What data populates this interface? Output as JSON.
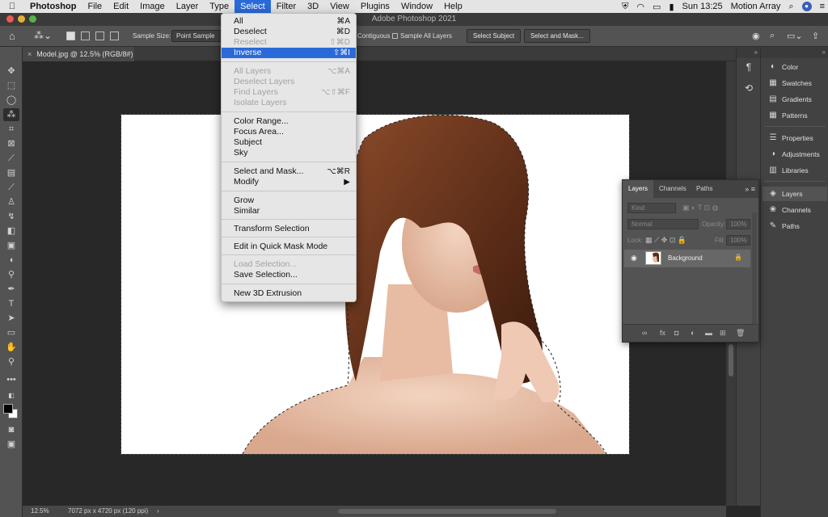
{
  "menubar": {
    "apple": "",
    "items": [
      "Photoshop",
      "File",
      "Edit",
      "Image",
      "Layer",
      "Type",
      "Select",
      "Filter",
      "3D",
      "View",
      "Plugins",
      "Window",
      "Help"
    ],
    "clock": "Sun 13:25",
    "user": "Motion Array"
  },
  "window": {
    "title": "Adobe Photoshop 2021"
  },
  "options": {
    "sample_size_label": "Sample Size:",
    "sample_size_value": "Point Sample",
    "contiguous": "Contiguous",
    "sample_all_layers": "Sample All Layers",
    "select_subject": "Select Subject",
    "select_and_mask": "Select and Mask..."
  },
  "document": {
    "tab": "Model.jpg @ 12.5% (RGB/8#)"
  },
  "status": {
    "zoom": "12.5%",
    "info": "7072 px x 4720 px (120 ppi)",
    "chevron": "›"
  },
  "select_menu": {
    "items": [
      {
        "label": "All",
        "shortcut": "⌘A",
        "disabled": false
      },
      {
        "label": "Deselect",
        "shortcut": "⌘D",
        "disabled": false
      },
      {
        "label": "Reselect",
        "shortcut": "⇧⌘D",
        "disabled": true
      },
      {
        "label": "Inverse",
        "shortcut": "⇧⌘I",
        "disabled": false,
        "highlighted": true
      },
      {
        "label": "All Layers",
        "shortcut": "⌥⌘A",
        "disabled": true
      },
      {
        "label": "Deselect Layers",
        "shortcut": "",
        "disabled": true
      },
      {
        "label": "Find Layers",
        "shortcut": "⌥⇧⌘F",
        "disabled": true
      },
      {
        "label": "Isolate Layers",
        "shortcut": "",
        "disabled": true
      },
      {
        "label": "Color Range...",
        "shortcut": "",
        "disabled": false
      },
      {
        "label": "Focus Area...",
        "shortcut": "",
        "disabled": false
      },
      {
        "label": "Subject",
        "shortcut": "",
        "disabled": false
      },
      {
        "label": "Sky",
        "shortcut": "",
        "disabled": false
      },
      {
        "label": "Select and Mask...",
        "shortcut": "⌥⌘R",
        "disabled": false
      },
      {
        "label": "Modify",
        "shortcut": "▶",
        "disabled": false
      },
      {
        "label": "Grow",
        "shortcut": "",
        "disabled": false
      },
      {
        "label": "Similar",
        "shortcut": "",
        "disabled": false
      },
      {
        "label": "Transform Selection",
        "shortcut": "",
        "disabled": false
      },
      {
        "label": "Edit in Quick Mask Mode",
        "shortcut": "",
        "disabled": false
      },
      {
        "label": "Load Selection...",
        "shortcut": "",
        "disabled": true
      },
      {
        "label": "Save Selection...",
        "shortcut": "",
        "disabled": false
      },
      {
        "label": "New 3D Extrusion",
        "shortcut": "",
        "disabled": false
      }
    ]
  },
  "right_panels": {
    "groups": [
      "Color",
      "Swatches",
      "Gradients",
      "Patterns",
      "Properties",
      "Adjustments",
      "Libraries",
      "Layers",
      "Channels",
      "Paths"
    ]
  },
  "layers_panel": {
    "tabs": [
      "Layers",
      "Channels",
      "Paths"
    ],
    "kind": "Kind",
    "blend": "Normal",
    "opacity_label": "Opacity:",
    "opacity_value": "100%",
    "lock_label": "Lock:",
    "fill_label": "Fill:",
    "fill_value": "100%",
    "layer_name": "Background"
  },
  "colors": {
    "menu_highlight": "#2a6ad8",
    "panel": "#535353",
    "canvas_bg": "#282828"
  }
}
